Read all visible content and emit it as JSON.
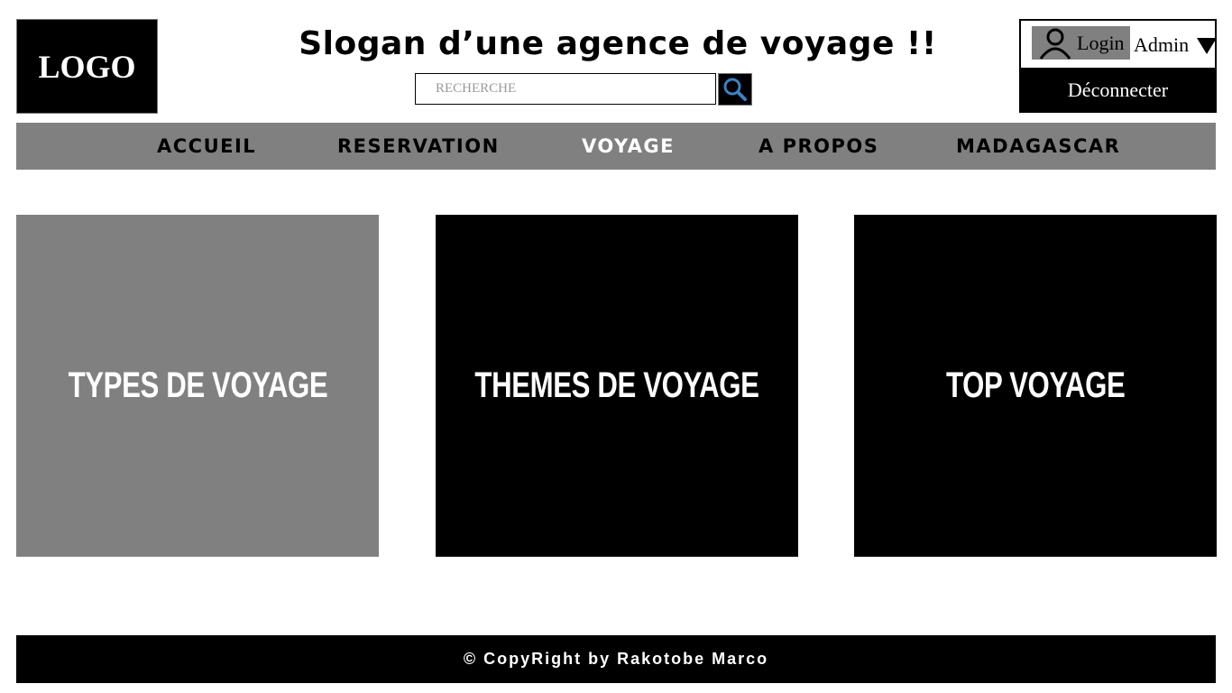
{
  "header": {
    "logo_text": "LOGO",
    "slogan": "Slogan d’une agence de voyage !!",
    "search": {
      "placeholder": "RECHERCHE",
      "icon": "search-icon"
    }
  },
  "user": {
    "login_label": "Login",
    "admin_label": "Admin",
    "logout_label": "Déconnecter",
    "icon": "user-icon"
  },
  "nav": {
    "items": [
      {
        "label": "ACCUEIL"
      },
      {
        "label": "RESERVATION"
      },
      {
        "label": "VOYAGE",
        "active": true
      },
      {
        "label": "A PROPOS"
      },
      {
        "label": "MADAGASCAR"
      }
    ]
  },
  "cards": [
    {
      "label": "TYPES DE VOYAGE",
      "color": "#808080"
    },
    {
      "label": "THEMES DE VOYAGE",
      "color": "#000000"
    },
    {
      "label": "TOP VOYAGE",
      "color": "#000000"
    }
  ],
  "footer": {
    "text": "© CopyRight by Rakotobe Marco"
  },
  "colors": {
    "nav_bg": "#808080",
    "dark": "#000000",
    "active_nav_text": "#ffffff"
  }
}
